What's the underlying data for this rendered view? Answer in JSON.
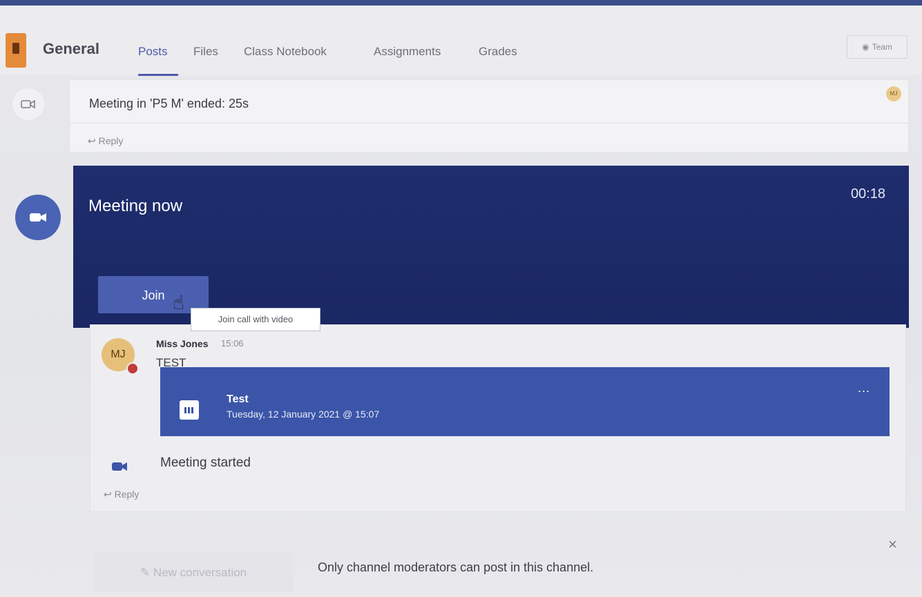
{
  "header": {
    "channel_name": "General",
    "tabs": [
      {
        "label": "Posts",
        "active": true
      },
      {
        "label": "Files",
        "active": false
      },
      {
        "label": "Class Notebook",
        "active": false
      },
      {
        "label": "Assignments",
        "active": false
      },
      {
        "label": "Grades",
        "active": false
      }
    ],
    "team_button": "Team"
  },
  "ended_meeting": {
    "title": "Meeting in 'P5 M' ended: 25s",
    "reply_label": "Reply",
    "avatar_initials": "MJ"
  },
  "meeting_now": {
    "title": "Meeting now",
    "timer": "00:18",
    "join_label": "Join",
    "tooltip": "Join call with video"
  },
  "message": {
    "avatar_initials": "MJ",
    "author": "Miss Jones",
    "time": "15:06",
    "text": "TEST",
    "event": {
      "title": "Test",
      "date": "Tuesday, 12 January 2021 @ 15:07",
      "more": "..."
    },
    "status": "Meeting started",
    "reply_label": "Reply"
  },
  "footer": {
    "new_conversation": "New conversation",
    "notice": "Only channel moderators can post in this channel.",
    "close": "×"
  },
  "colors": {
    "accent": "#4c5aa8",
    "meeting_bg": "#1f2d6e",
    "event_bg": "#3b55a9",
    "presence_busy": "#c23b3b"
  }
}
